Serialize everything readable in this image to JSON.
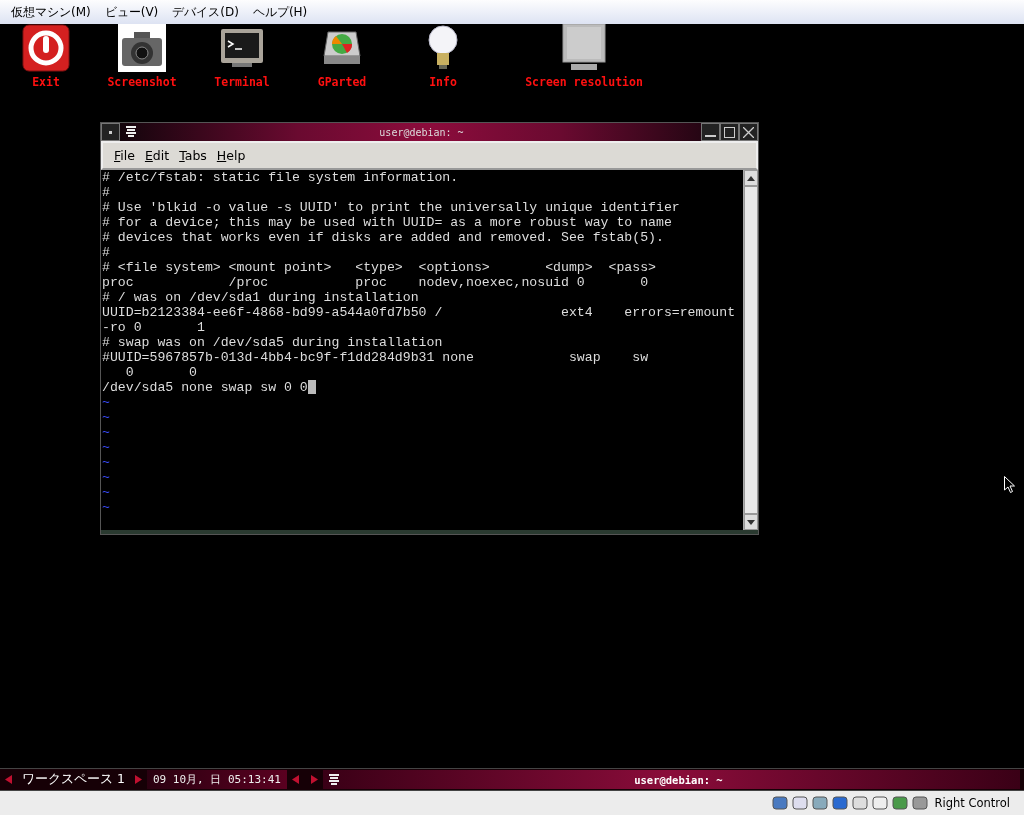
{
  "menu_bar": {
    "items": [
      "仮想マシン(M)",
      "ビュー(V)",
      "デバイス(D)",
      "ヘルプ(H)"
    ]
  },
  "launchers": [
    {
      "label": "Exit",
      "kind": "power"
    },
    {
      "label": "Screenshot",
      "kind": "camera"
    },
    {
      "label": "Terminal",
      "kind": "terminal"
    },
    {
      "label": "GParted",
      "kind": "disk"
    },
    {
      "label": "Info",
      "kind": "bulb"
    },
    {
      "label": "Screen resolution",
      "kind": "monitor"
    }
  ],
  "terminal_window": {
    "title": "user@debian: ~",
    "menu": [
      "File",
      "Edit",
      "Tabs",
      "Help"
    ],
    "lines": [
      "# /etc/fstab: static file system information.",
      "#",
      "# Use 'blkid -o value -s UUID' to print the universally unique identifier",
      "# for a device; this may be used with UUID= as a more robust way to name",
      "# devices that works even if disks are added and removed. See fstab(5).",
      "#",
      "# <file system> <mount point>   <type>  <options>       <dump>  <pass>",
      "proc            /proc           proc    nodev,noexec,nosuid 0       0",
      "# / was on /dev/sda1 during installation",
      "UUID=b2123384-ee6f-4868-bd99-a544a0fd7b50 /               ext4    errors=remount",
      "-ro 0       1",
      "# swap was on /dev/sda5 during installation",
      "#UUID=5967857b-013d-4bb4-bc9f-f1dd284d9b31 none            swap    sw",
      "   0       0",
      "/dev/sda5 none swap sw 0 0"
    ],
    "empty_line_markers": [
      "~",
      "~",
      "~",
      "~",
      "~",
      "~",
      "~",
      "~"
    ]
  },
  "taskbar": {
    "workspace": "ワークスペース 1",
    "clock": "09 10月, 日 05:13:41",
    "window_button": "user@debian: ~"
  },
  "status_bar": {
    "host_key": "Right Control"
  }
}
